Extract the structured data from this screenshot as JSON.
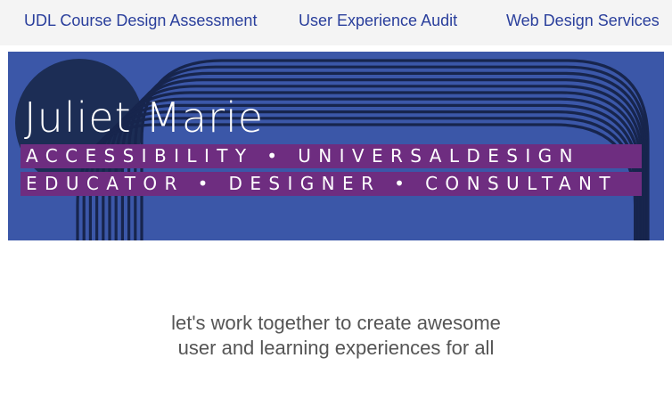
{
  "nav": {
    "items": [
      {
        "label": "UDL Course Design Assessment"
      },
      {
        "label": "User Experience Audit"
      },
      {
        "label": "Web Design Services"
      }
    ]
  },
  "banner": {
    "name": "Juliet Marie",
    "line1": "ACCESSIBILITY • UNIVERSALDESIGN",
    "line2": "EDUCATOR • DESIGNER • CONSULTANT",
    "colors": {
      "background": "#3b57a8",
      "circle": "#1c2d55",
      "stripes": "#17254d",
      "tag_bar": "#6e2d80"
    }
  },
  "tagline": {
    "line1": "let's work together to create awesome",
    "line2": "user and learning experiences for all"
  }
}
